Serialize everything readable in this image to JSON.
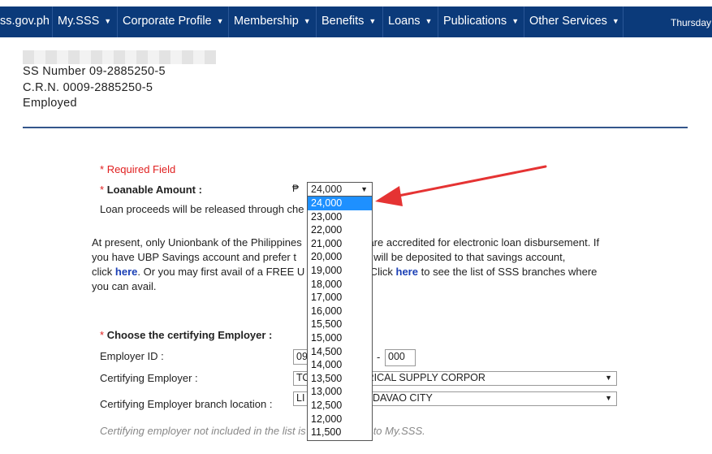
{
  "nav": {
    "items": [
      {
        "label": "ss.gov.ph",
        "caret": false
      },
      {
        "label": "My.SSS",
        "caret": true
      },
      {
        "label": "Corporate Profile",
        "caret": true
      },
      {
        "label": "Membership",
        "caret": true
      },
      {
        "label": "Benefits",
        "caret": true
      },
      {
        "label": "Loans",
        "caret": true
      },
      {
        "label": "Publications",
        "caret": true
      },
      {
        "label": "Other Services",
        "caret": true
      }
    ],
    "date": "Thursday",
    "bg_color": "#0b3a7a"
  },
  "member": {
    "ss_number": "SS Number 09-2885250-5",
    "crn": "C.R.N. 0009-2885250-5",
    "status": "Employed"
  },
  "form": {
    "required_star": "*",
    "required_note": "Required Field",
    "loanable_label": "Loanable Amount :",
    "currency_symbol": "₱",
    "loanable_selected": "24,000",
    "loanable_options": [
      "24,000",
      "23,000",
      "22,000",
      "21,000",
      "20,000",
      "19,000",
      "18,000",
      "17,000",
      "16,000",
      "15,500",
      "15,000",
      "14,500",
      "14,000",
      "13,500",
      "13,000",
      "12,500",
      "12,000",
      "11,500"
    ],
    "release_text": "Loan proceeds will be released through che",
    "para_1": "At present, only Unionbank of the Philippines",
    "para_1b": "ts are accredited for electronic loan disbursement. If",
    "para_2": "you have UBP Savings account and prefer t",
    "para_2b": "proceeds will be deposited to that savings account,",
    "para_3a": "click",
    "link_here_1": "here",
    "para_3b": ". Or you may first avail of a FREE U",
    "para_3c": "d. Click",
    "link_here_2": "here",
    "para_3d": "to see the list of SSS branches where",
    "para_4": "you can avail.",
    "choose_employer": "Choose the certifying Employer :",
    "employer_id_label": "Employer ID :",
    "employer_id_prefix": "09",
    "employer_id_dash": "-",
    "employer_id_suffix": "000",
    "certifying_employer_label": "Certifying Employer :",
    "certifying_employer_value": "TO                    RICAL SUPPLY CORPOR",
    "branch_label": "Certifying Employer branch location :",
    "branch_value": "LI                     T DAVAO CITY",
    "note": "Certifying employer not included in the list is                    d to My.SSS."
  },
  "colors": {
    "required": "#e02020",
    "link": "#1a3fb5",
    "highlight": "#1e90ff",
    "annotation_arrow": "#e53333",
    "divider": "#34568b"
  }
}
